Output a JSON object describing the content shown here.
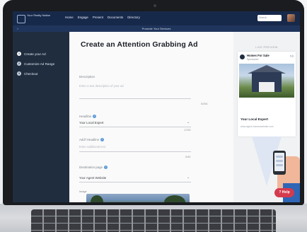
{
  "topnav": {
    "logo_text": "Your Realty Nation",
    "links": [
      "Home",
      "Engage",
      "Present",
      "Documents",
      "Directory"
    ],
    "search_placeholder": "Search"
  },
  "subbar": {
    "left": "«",
    "title": "Promote Your Services"
  },
  "sidebar": {
    "steps": [
      {
        "num": "1",
        "label": "Create your Ad"
      },
      {
        "num": "2",
        "label": "Customize Ad Range"
      },
      {
        "num": "3",
        "label": "Checkout"
      }
    ]
  },
  "form": {
    "title": "Create an Attention Grabbing Ad",
    "description": {
      "label": "Description",
      "placeholder": "Enter a text description of your ad",
      "count": "0/254"
    },
    "headline": {
      "label": "Headline",
      "value": "Your Local Expert",
      "count": "17/25"
    },
    "additional_text": {
      "label": "Add'l Headline",
      "placeholder": "Enter additional text",
      "count": "0/40"
    },
    "destination": {
      "label": "Destination page",
      "value": "Your Agent Website"
    },
    "image": {
      "label": "Image"
    }
  },
  "preview": {
    "label": "LIVE PREVIEW",
    "card_title": "Homes For Sale",
    "card_sub": "Sponsored",
    "agent_name": "Your Local Expert",
    "url": "www.agent-homeswebsite.com"
  },
  "help_button": {
    "label": "Help"
  },
  "colors": {
    "nav": "#17294a",
    "sidebar": "#1f2d3f",
    "help": "#d43b4e",
    "info": "#5b9bd8"
  }
}
